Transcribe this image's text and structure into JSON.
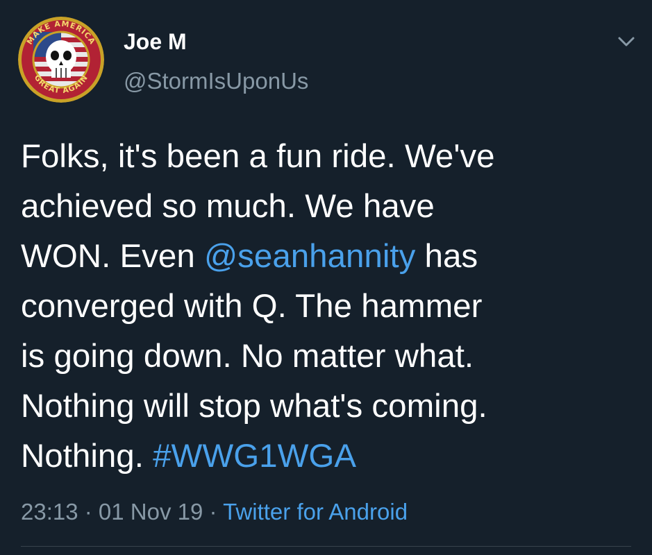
{
  "user": {
    "name": "Joe M",
    "handle": "@StormIsUponUs",
    "avatar_text_top": "MAKE AMERICA",
    "avatar_text_bottom": "GREAT AGAIN"
  },
  "tweet": {
    "line1": "Folks, it's been a fun ride. We've",
    "line2": "achieved so much. We have",
    "line3_pre": "WON. Even ",
    "mention": "@seanhannity",
    "line3_post": " has",
    "line4": "converged with Q. The hammer",
    "line5": "is going down. No matter what.",
    "line6": "Nothing will stop what's coming.",
    "line7_pre": "Nothing. ",
    "hashtag": "#WWG1WGA"
  },
  "meta": {
    "time": "23:13",
    "sep1": " · ",
    "date": "01 Nov 19",
    "sep2": " · ",
    "source": "Twitter for Android"
  },
  "colors": {
    "background": "#15202b",
    "text": "#ffffff",
    "secondary": "#8899a6",
    "link": "#4aa1eb"
  },
  "icons": {
    "menu": "chevron-down-icon",
    "avatar": "punisher-skull-badge"
  }
}
